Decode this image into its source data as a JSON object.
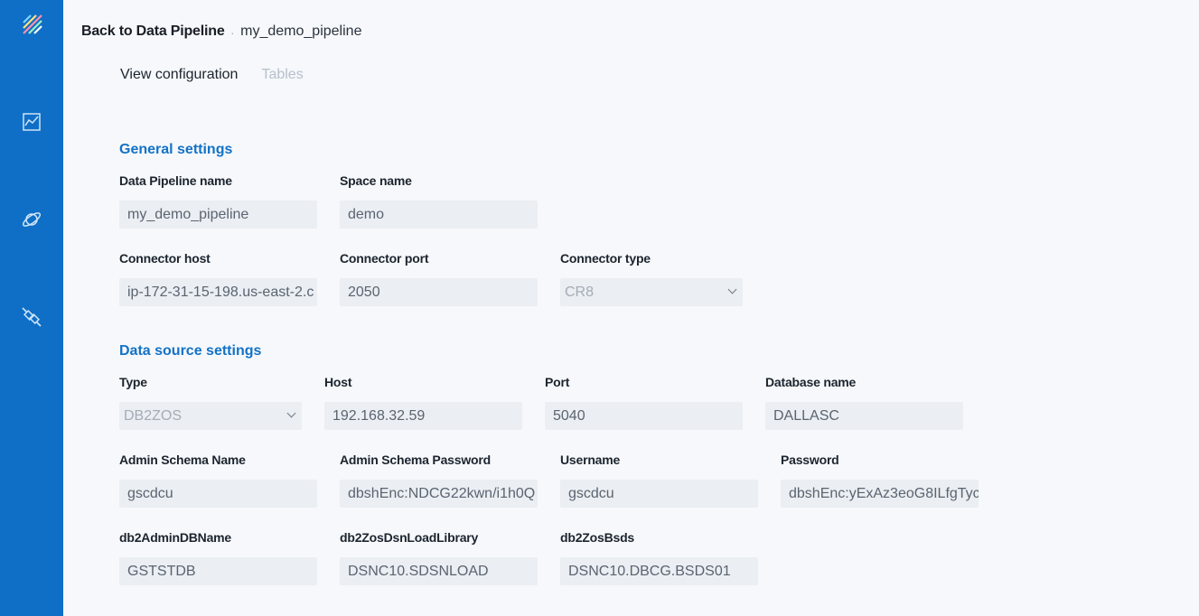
{
  "sidebar": {
    "icons": [
      "logo-icon",
      "chart-icon",
      "planet-icon",
      "plug-icon"
    ],
    "brand_color": "#0f6fc6"
  },
  "breadcrumb": {
    "back_label": "Back to Data Pipeline",
    "separator": ".",
    "current": "my_demo_pipeline"
  },
  "tabs": [
    {
      "label": "View configuration",
      "active": true
    },
    {
      "label": "Tables",
      "active": false
    }
  ],
  "general": {
    "title": "General settings",
    "pipeline_name": {
      "label": "Data Pipeline name",
      "value": "my_demo_pipeline"
    },
    "space_name": {
      "label": "Space name",
      "value": "demo"
    },
    "connector_host": {
      "label": "Connector host",
      "value": "ip-172-31-15-198.us-east-2.c"
    },
    "connector_port": {
      "label": "Connector port",
      "value": "2050"
    },
    "connector_type": {
      "label": "Connector type",
      "value": "CR8"
    }
  },
  "source": {
    "title": "Data source settings",
    "type": {
      "label": "Type",
      "value": "DB2ZOS"
    },
    "host": {
      "label": "Host",
      "value": "192.168.32.59"
    },
    "port": {
      "label": "Port",
      "value": "5040"
    },
    "database_name": {
      "label": "Database name",
      "value": "DALLASC"
    },
    "admin_schema_name": {
      "label": "Admin Schema Name",
      "value": "gscdcu"
    },
    "admin_schema_password": {
      "label": "Admin Schema Password",
      "value": "dbshEnc:NDCG22kwn/i1h0Q"
    },
    "username": {
      "label": "Username",
      "value": "gscdcu"
    },
    "password": {
      "label": "Password",
      "value": "dbshEnc:yExAz3eoG8ILfgTyc"
    },
    "db2_admin_db_name": {
      "label": "db2AdminDBName",
      "value": "GSTSTDB"
    },
    "db2_zos_dsn_load_library": {
      "label": "db2ZosDsnLoadLibrary",
      "value": "DSNC10.SDSNLOAD"
    },
    "db2_zos_bsds": {
      "label": "db2ZosBsds",
      "value": "DSNC10.DBCG.BSDS01"
    }
  }
}
